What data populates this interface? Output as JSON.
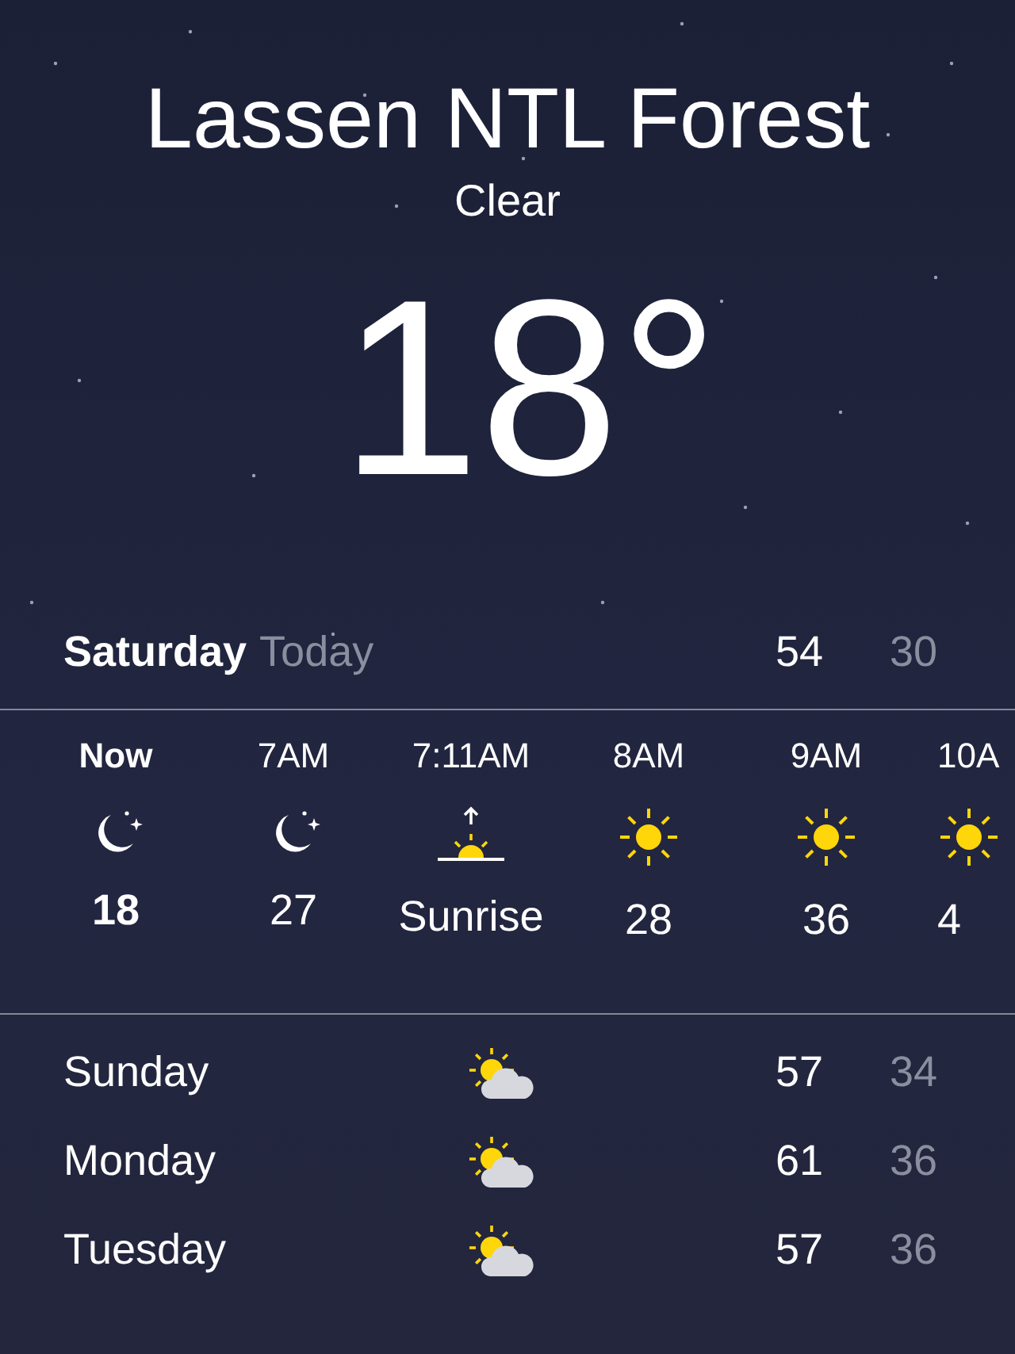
{
  "location": "Lassen NTL Forest",
  "condition": "Clear",
  "temperature": "18°",
  "today": {
    "day": "Saturday",
    "label": "Today",
    "high": "54",
    "low": "30"
  },
  "hourly": [
    {
      "time": "Now",
      "kind": "night",
      "value": "18",
      "current": true
    },
    {
      "time": "7AM",
      "kind": "night",
      "value": "27",
      "current": false
    },
    {
      "time": "7:11AM",
      "kind": "sunrise",
      "value": "Sunrise",
      "current": false
    },
    {
      "time": "8AM",
      "kind": "sun",
      "value": "28",
      "current": false
    },
    {
      "time": "9AM",
      "kind": "sun",
      "value": "36",
      "current": false
    },
    {
      "time": "10A",
      "kind": "sun",
      "value": "4",
      "current": false
    }
  ],
  "daily": [
    {
      "day": "Sunday",
      "kind": "partly-cloudy",
      "high": "57",
      "low": "34"
    },
    {
      "day": "Monday",
      "kind": "partly-cloudy",
      "high": "61",
      "low": "36"
    },
    {
      "day": "Tuesday",
      "kind": "partly-cloudy",
      "high": "57",
      "low": "36"
    }
  ]
}
